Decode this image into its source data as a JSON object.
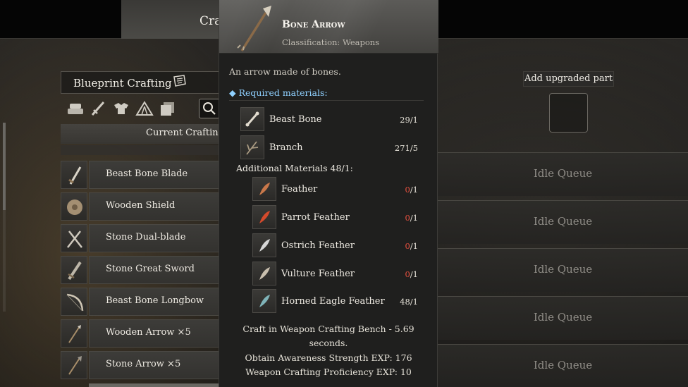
{
  "top_tab": {
    "label": "Cra"
  },
  "blueprint": {
    "title": "Blueprint Crafting",
    "title_icon": "blueprint-scroll-icon",
    "categories": [
      "materials-icon",
      "weapons-icon",
      "armor-icon",
      "tent-icon",
      "cards-icon"
    ],
    "search_icon": "search-icon",
    "current_crafting_label": "Current Crafting",
    "items": [
      {
        "name": "Beast Bone Blade",
        "icon": "bone-blade-icon"
      },
      {
        "name": "Wooden Shield",
        "icon": "wooden-shield-icon"
      },
      {
        "name": "Stone Dual-blade",
        "icon": "dual-blade-icon"
      },
      {
        "name": "Stone Great Sword",
        "icon": "great-sword-icon"
      },
      {
        "name": "Beast Bone Longbow",
        "icon": "longbow-icon"
      },
      {
        "name": "Wooden Arrow ×5",
        "icon": "wooden-arrow-icon"
      },
      {
        "name": "Stone Arrow ×5",
        "icon": "stone-arrow-icon"
      }
    ]
  },
  "upgrade": {
    "label": "Add upgraded part"
  },
  "queues": [
    "Idle Queue",
    "Idle Queue",
    "Idle Queue",
    "Idle Queue",
    "Idle Queue"
  ],
  "tooltip": {
    "item_name": "Bone Arrow",
    "classification": "Classification: Weapons",
    "description": "An arrow made of bones.",
    "required_label": "Required materials:",
    "required": [
      {
        "name": "Beast Bone",
        "have": "29",
        "need": "/1",
        "icon": "beast-bone-icon",
        "insufficient": false
      },
      {
        "name": "Branch",
        "have": "271",
        "need": "/5",
        "icon": "branch-icon",
        "insufficient": false
      }
    ],
    "additional_label": "Additional Materials 48/1:",
    "additional": [
      {
        "name": "Feather",
        "have": "0",
        "need": "/1",
        "icon": "feather-icon",
        "insufficient": true
      },
      {
        "name": "Parrot Feather",
        "have": "0",
        "need": "/1",
        "icon": "parrot-feather-icon",
        "insufficient": true
      },
      {
        "name": "Ostrich Feather",
        "have": "0",
        "need": "/1",
        "icon": "ostrich-feather-icon",
        "insufficient": true
      },
      {
        "name": "Vulture Feather",
        "have": "0",
        "need": "/1",
        "icon": "vulture-feather-icon",
        "insufficient": true
      },
      {
        "name": "Horned Eagle Feather",
        "have": "48",
        "need": "/1",
        "icon": "horned-eagle-feather-icon",
        "insufficient": false
      }
    ],
    "craft_line1": "Craft in Weapon Crafting Bench - 5.69",
    "craft_line2": "seconds.",
    "exp_awareness": "Obtain Awareness Strength EXP: 176",
    "exp_proficiency": "Weapon Crafting Proficiency EXP: 10"
  },
  "colors": {
    "accent_blue": "#8fd0ff",
    "insufficient_red": "#e5503f"
  }
}
